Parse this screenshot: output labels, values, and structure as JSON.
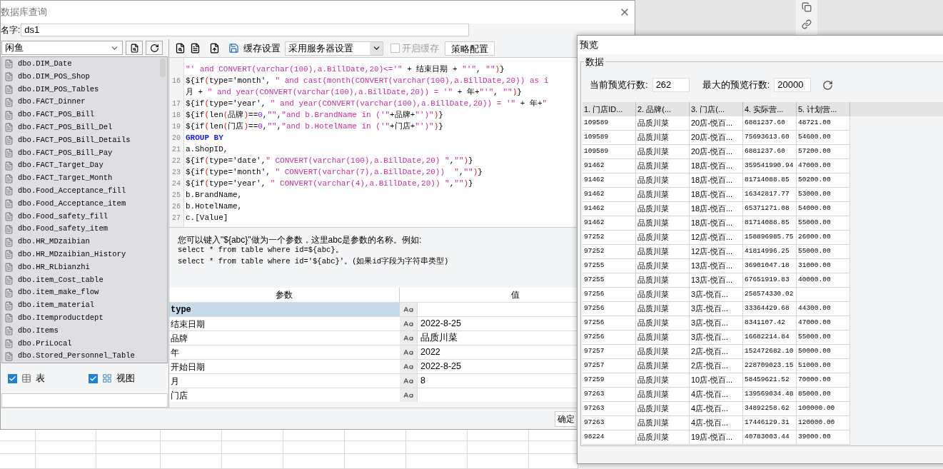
{
  "dialog": {
    "title": "数据库查询",
    "name_label": "名字:",
    "name_value": "ds1",
    "connection": "闲鱼",
    "tables": [
      "dbo.DIM_Date",
      "dbo.DIM_POS_Shop",
      "dbo.DIM_POS_Tables",
      "dbo.FACT_Dinner",
      "dbo.FACT_POS_Bill",
      "dbo.FACT_POS_Bill_Del",
      "dbo.FACT_POS_Bill_Details",
      "dbo.FACT_POS_Bill_Pay",
      "dbo.FACT_Target_Day",
      "dbo.FACT_Target_Month",
      "dbo.Food_Acceptance_fill",
      "dbo.Food_Acceptance_item",
      "dbo.Food_safety_fill",
      "dbo.Food_safety_item",
      "dbo.HR_MDzaibian",
      "dbo.HR_MDzaibian_History",
      "dbo.HR_RLbianzhi",
      "dbo.item_Cost_table",
      "dbo.item_make_flow",
      "dbo.item_material",
      "dbo.Itemproductdept",
      "dbo.Items",
      "dbo.PriLocal",
      "dbo.Stored_Personnel_Table"
    ],
    "filters": [
      {
        "label": "表",
        "checked": true,
        "kind": "table"
      },
      {
        "label": "视图",
        "checked": true,
        "kind": "view"
      }
    ],
    "cache_label": "缓存设置",
    "cache_mode": "采用服务器设置",
    "cache_enable": {
      "label": "开启缓存",
      "checked": false,
      "disabled": true
    },
    "strategy_button": "策略配置",
    "code_lines": [
      {
        "text": "\"' and CONVERT(varchar(100),a.BillDate,20)<='\" + 结束日期 + \"'\", \"\")}",
        "kind": "code"
      },
      {
        "num": "16",
        "text": "${if(type='month', \" and cast(month(CONVERT(varchar(100),a.BillDate,20)) as i",
        "kind": "code"
      },
      {
        "text": "月 + \" and year(CONVERT(varchar(100),a.BillDate,20)) = '\" + 年+\"'\", \"\")}",
        "kind": "code"
      },
      {
        "num": "17",
        "text": "${if(type='year', \" and year(CONVERT(varchar(100),a.BillDate,20)) = '\" + 年+\"",
        "kind": "code"
      },
      {
        "num": "18",
        "text": "${if(len(品牌)==0,\"\",\"and b.BrandName in ('\"+品牌+\"')\")}",
        "kind": "code"
      },
      {
        "num": "19",
        "text": "${if(len(门店)==0,\"\",\"and b.HotelName in ('\"+门店+\"')\")}",
        "kind": "code"
      },
      {
        "num": "20",
        "text": "GROUP BY",
        "kind": "keyword"
      },
      {
        "num": "21",
        "text": "a.ShopID,",
        "kind": "code"
      },
      {
        "num": "22",
        "text": "${if(type='date',\" CONVERT(varchar(100),a.BillDate,20) \",\"\")}",
        "kind": "code"
      },
      {
        "num": "23",
        "text": "${if(type='month', \" CONVERT(varchar(7),a.BillDate,20))  \",\"\")}",
        "kind": "code"
      },
      {
        "num": "24",
        "text": "${if(type='year', \" CONVERT(varchar(4),a.BillDate,20)) \",\"\")}",
        "kind": "code"
      },
      {
        "num": "25",
        "text": "b.BrandName,",
        "kind": "code"
      },
      {
        "num": "26",
        "text": "b.HotelName,",
        "kind": "code"
      },
      {
        "num": "27",
        "text": "c.[Value]",
        "kind": "code"
      }
    ],
    "help_lines": [
      "您可以键入\"${abc}\"做为一个参数，这里abc是参数的名称。例如:",
      "select * from table where id=${abc}。",
      "select * from table where id='${abc}'。(如果id字段为字符串类型)"
    ],
    "params_columns": [
      "参数",
      "值"
    ],
    "params": [
      {
        "name": "type",
        "selected": true
      },
      {
        "name": "结束日期",
        "value": "2022-8-25",
        "selected": false
      },
      {
        "name": "品牌",
        "value": "品质川菜",
        "selected": false
      },
      {
        "name": "年",
        "value": "2022",
        "selected": false
      },
      {
        "name": "开始日期",
        "value": "2022-8-25",
        "selected": false
      },
      {
        "name": "月",
        "value": "8",
        "selected": false
      },
      {
        "name": "门店",
        "selected": false
      }
    ],
    "ok_button": "确定"
  },
  "preview": {
    "title": "预览",
    "group": "数据",
    "current_rows_label": "当前预览行数:",
    "current_rows": "262",
    "max_rows_label": "最大的预览行数:",
    "max_rows": "20000",
    "columns": [
      "1. 门店ID...",
      "2. 品牌(...",
      "3. 门店(...",
      "4. 实际营...",
      "5. 计划营..."
    ],
    "rows": [
      [
        "109589",
        "品质川菜",
        "20店-悦百...",
        "6881237.60",
        "48721.00"
      ],
      [
        "109589",
        "品质川菜",
        "20店-悦百...",
        "75693613.60",
        "54600.00"
      ],
      [
        "109589",
        "品质川菜",
        "20店-悦百...",
        "6881237.60",
        "57200.00"
      ],
      [
        "91462",
        "品质川菜",
        "18店-悦百...",
        "359541990.94",
        "47000.00"
      ],
      [
        "91462",
        "品质川菜",
        "18店-悦百...",
        "81714088.85",
        "50200.00"
      ],
      [
        "91462",
        "品质川菜",
        "18店-悦百...",
        "16342817.77",
        "53000.00"
      ],
      [
        "91462",
        "品质川菜",
        "18店-悦百...",
        "65371271.08",
        "54000.00"
      ],
      [
        "91462",
        "品质川菜",
        "18店-悦百...",
        "81714088.85",
        "55000.00"
      ],
      [
        "97252",
        "品质川菜",
        "12店-悦百...",
        "158896985.75",
        "26000.00"
      ],
      [
        "97252",
        "品质川菜",
        "12店-悦百...",
        "41814996.25",
        "55000.00"
      ],
      [
        "97255",
        "品质川菜",
        "13店-悦百...",
        "36901047.18",
        "31000.00"
      ],
      [
        "97255",
        "品质川菜",
        "13店-悦百...",
        "67651919.83",
        "40000.00"
      ],
      [
        "97256",
        "品质川菜",
        "3店-悦百...",
        "258574330.02",
        null
      ],
      [
        "97256",
        "品质川菜",
        "3店-悦百...",
        "33364429.68",
        "44300.00"
      ],
      [
        "97256",
        "品质川菜",
        "3店-悦百...",
        "8341107.42",
        "47000.00"
      ],
      [
        "97256",
        "品质川菜",
        "3店-悦百...",
        "16682214.84",
        "55000.00"
      ],
      [
        "97257",
        "品质川菜",
        "2店-悦百...",
        "152472682.10",
        "50000.00"
      ],
      [
        "97257",
        "品质川菜",
        "2店-悦百...",
        "228709023.15",
        "51000.00"
      ],
      [
        "97259",
        "品质川菜",
        "10店-悦百...",
        "58459621.52",
        "70000.00"
      ],
      [
        "97263",
        "品质川菜",
        "4店-悦百...",
        "139569034.48",
        "85000.00"
      ],
      [
        "97263",
        "品质川菜",
        "4店-悦百...",
        "34892258.62",
        "100000.00"
      ],
      [
        "97263",
        "品质川菜",
        "4店-悦百...",
        "17446129.31",
        "120000.00"
      ],
      [
        "98224",
        "品质川菜",
        "19店-悦百...",
        "40783003.44",
        "39000.00"
      ]
    ]
  }
}
